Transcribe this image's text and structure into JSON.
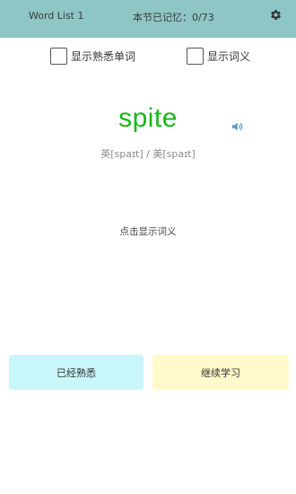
{
  "header": {
    "list_title": "Word List 1",
    "progress": "本节已记忆：0/73",
    "settings_icon": "gear-icon"
  },
  "options": {
    "show_familiar": "显示熟悉单词",
    "show_meaning": "显示词义"
  },
  "word": {
    "text": "spite",
    "phonetic": "英[spaɪt]  /  美[spaɪt]",
    "speaker_icon": "speaker-icon"
  },
  "reveal_prompt": "点击显示词义",
  "buttons": {
    "known": "已经熟悉",
    "continue": "继续学习"
  },
  "colors": {
    "header_bg": "#8ec5c5",
    "word": "#17b717",
    "known_button_bg": "#c9f6fb",
    "continue_button_bg": "#fff9cc"
  }
}
